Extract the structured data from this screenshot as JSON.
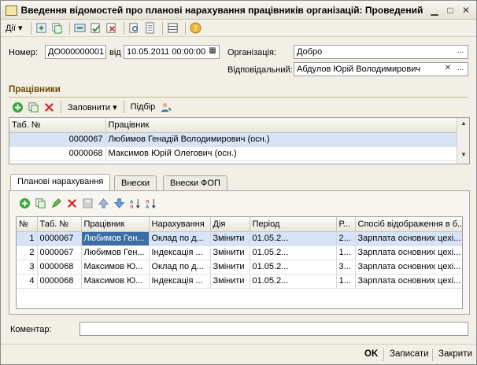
{
  "window": {
    "title": "Введення відомостей про планові нарахування працівників організацій: Проведений"
  },
  "toolbar": {
    "actions_menu": "Дії",
    "icons": [
      "add-icon",
      "copy-icon",
      "refresh-icon",
      "post-icon",
      "unpost-icon",
      "preview-icon",
      "print-icon",
      "structure-icon",
      "help-icon"
    ]
  },
  "header": {
    "number_label": "Номер:",
    "number_value": "ДО000000001",
    "date_label": "від",
    "date_value": "10.05.2011 00:00:00",
    "org_label": "Організація:",
    "org_value": "Добро",
    "resp_label": "Відповідальний:",
    "resp_value": "Абдулов Юрій Володимирович"
  },
  "employees": {
    "title": "Працівники",
    "fill_button": "Заповнити",
    "select_button": "Підбір",
    "columns": [
      "Таб. №",
      "Працівник"
    ],
    "rows": [
      {
        "tab_no": "0000067",
        "name": "Любимов Генадій Володимирович (осн.)"
      },
      {
        "tab_no": "0000068",
        "name": "Максимов Юрій Олегович (осн.)"
      }
    ]
  },
  "tabs": [
    {
      "label": "Планові нарахування"
    },
    {
      "label": "Внески"
    },
    {
      "label": "Внески ФОП"
    }
  ],
  "accruals": {
    "columns": [
      "№",
      "Таб. №",
      "Працівник",
      "Нарахування",
      "Дія",
      "Період",
      "Р...",
      "Спосіб відображення в б..."
    ],
    "rows": [
      {
        "n": "1",
        "tab_no": "0000067",
        "employee": "Любимов Ген...",
        "accrual": "Оклад по д...",
        "action": "Змінити",
        "period": "01.05.2...",
        "r": "2...",
        "method": "Зарплата основних цехі..."
      },
      {
        "n": "2",
        "tab_no": "0000067",
        "employee": "Любимов Ген...",
        "accrual": "Індексація ...",
        "action": "Змінити",
        "period": "01.05.2...",
        "r": "1...",
        "method": "Зарплата основних цехі..."
      },
      {
        "n": "3",
        "tab_no": "0000068",
        "employee": "Максимов Ю...",
        "accrual": "Оклад по д...",
        "action": "Змінити",
        "period": "01.05.2...",
        "r": "3...",
        "method": "Зарплата основних цехі..."
      },
      {
        "n": "4",
        "tab_no": "0000068",
        "employee": "Максимов Ю...",
        "accrual": "Індексація ...",
        "action": "Змінити",
        "period": "01.05.2...",
        "r": "1...",
        "method": "Зарплата основних цехі..."
      }
    ]
  },
  "comment": {
    "label": "Коментар:",
    "value": ""
  },
  "footer": {
    "ok": "OK",
    "save": "Записати",
    "close": "Закрити"
  }
}
